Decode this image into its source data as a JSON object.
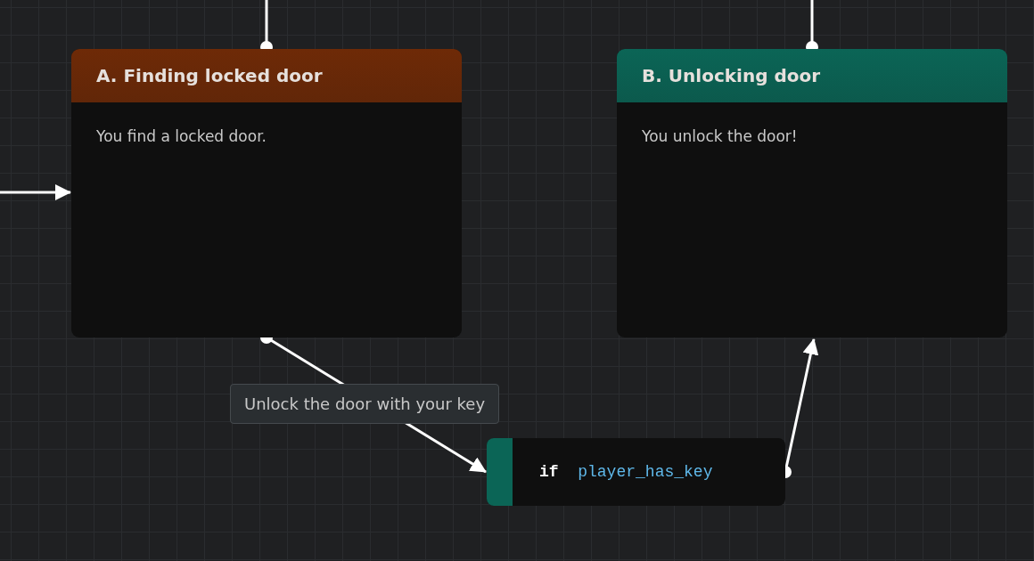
{
  "nodes": [
    {
      "kind": "passage",
      "title": "A. Finding locked door",
      "body": "You find a locked door.",
      "color": "#6e2a07"
    },
    {
      "kind": "passage",
      "title": "B. Unlocking door",
      "body": "You unlock the door!",
      "color": "#0b6556"
    },
    {
      "kind": "condition",
      "keyword": "if",
      "variable": "player_has_key",
      "color": "#0b6556"
    }
  ],
  "edge_label": "Unlock the door with your key"
}
